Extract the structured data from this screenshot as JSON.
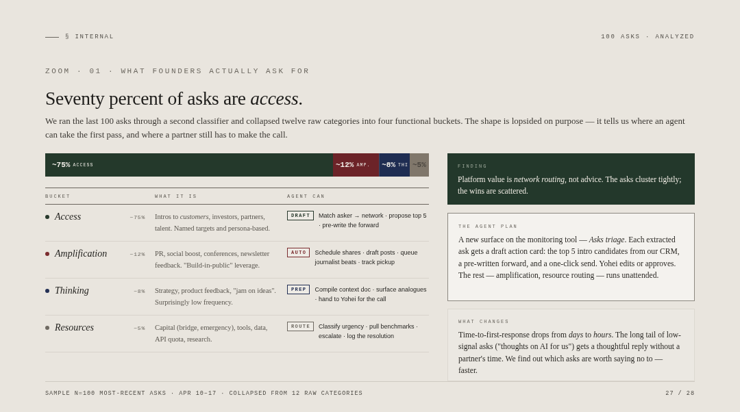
{
  "header": {
    "section": "§ INTERNAL",
    "meta": "100 ASKS · ANALYZED"
  },
  "kicker": "ZOOM · 01 · WHAT FOUNDERS ACTUALLY ASK FOR",
  "headline": "Seventy percent of asks are *access*.",
  "intro": "We ran the last 100 asks through a second classifier and collapsed twelve raw categories into four functional buckets. The shape is lopsided on purpose — it tells us where an agent can take the first pass, and where a partner still has to make the call.",
  "share_chart": {
    "chart_data": {
      "type": "bar",
      "orientation": "horizontal",
      "stacked": true,
      "series": [
        {
          "name": "ACCESS",
          "color": "#24392b",
          "values": [
            75
          ],
          "value_labels": [
            "~75%"
          ]
        },
        {
          "name": "AMP.",
          "color": "#6c2328",
          "values": [
            12
          ],
          "value_labels": [
            "~12%"
          ]
        },
        {
          "name": "THI",
          "color": "#1f2d52",
          "values": [
            8
          ],
          "value_labels": [
            "~8%"
          ]
        },
        {
          "color": "#80776b",
          "values": [
            5
          ],
          "value_labels": [
            "~5%"
          ]
        }
      ]
    }
  },
  "table": {
    "columns": [
      "BUCKET",
      "WHAT IT IS",
      "AGENT CAN"
    ],
    "rows": [
      {
        "bucket": "Access",
        "color": "#28392c",
        "share": "~75%",
        "description": "Intros to *customers*, investors, partners, talent. Named targets and persona-based.",
        "tag": "DRAFT",
        "actions": "Match asker → network · propose top 5 · pre-write the forward"
      },
      {
        "bucket": "Amplification",
        "color": "#7b2c2f",
        "share": "~12%",
        "description": "PR, social boost, conferences, newsletter feedback. \"Build-in-public\" leverage.",
        "tag": "AUTO",
        "actions": "Schedule shares · draft posts · queue journalist beats · track pickup"
      },
      {
        "bucket": "Thinking",
        "color": "#243055",
        "share": "~8%",
        "description": "Strategy, product feedback, \"jam on ideas\". Surprisingly low frequency.",
        "tag": "PREP",
        "actions": "Compile context doc · surface analogues · hand to Yohei for the call"
      },
      {
        "bucket": "Resources",
        "color": "#6f6a62",
        "share": "~5%",
        "description": "Capital (bridge, emergency), tools, data, API quota, research.",
        "tag": "ROUTE",
        "actions": "Classify urgency · pull benchmarks · escalate · log the resolution"
      }
    ]
  },
  "cards": [
    {
      "kind": "finding",
      "label": "FINDING",
      "text": "Platform value is *network routing*, not advice. The asks cluster tightly; the wins are scattered."
    },
    {
      "kind": "plan",
      "label": "THE AGENT PLAN",
      "text": "A new surface on the monitoring tool — *Asks triage*. Each extracted ask gets a draft action card: the top 5 intro candidates from our CRM, a pre-written forward, and a one-click send. Yohei edits or approves. The rest — amplification, resource routing — runs unattended."
    },
    {
      "kind": "changes",
      "label": "WHAT CHANGES",
      "text": "Time-to-first-response drops from *days* to *hours*. The long tail of low-signal asks (\"thoughts on AI for us\") gets a thoughtful reply without a partner's time. We find out which asks are worth saying no to — faster."
    }
  ],
  "footer": {
    "note": "SAMPLE N=100 MOST-RECENT ASKS · APR 10–17 · COLLAPSED FROM 12 RAW CATEGORIES",
    "page": "27 / 28"
  }
}
